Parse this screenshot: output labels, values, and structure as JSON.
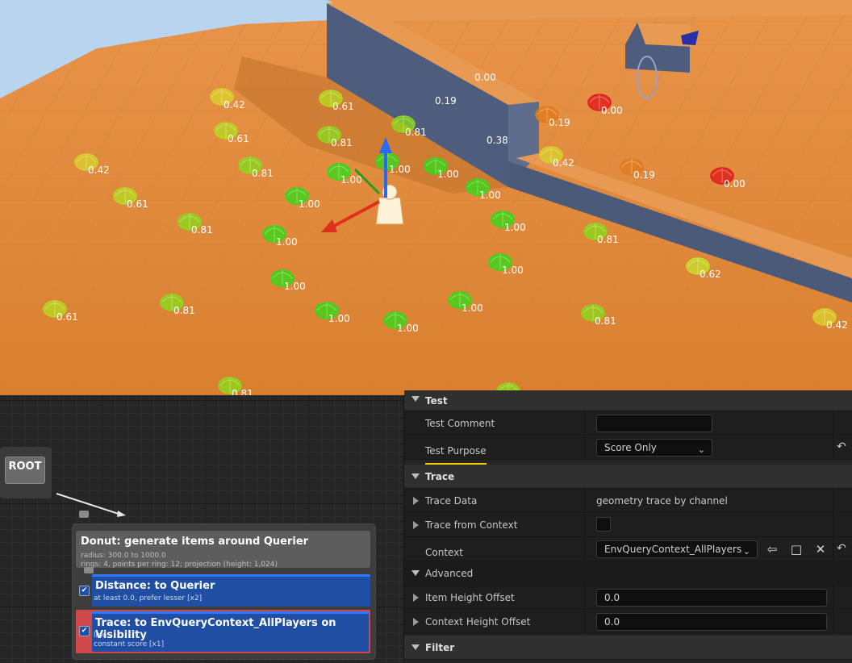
{
  "viewport": {
    "points": [
      {
        "label": "0.42",
        "color": "#d9cf2a"
      },
      {
        "label": "0.61",
        "color": "#b7d81f"
      },
      {
        "label": "0.61",
        "color": "#b7d81f"
      },
      {
        "label": "0.81",
        "color": "#8bd81a"
      },
      {
        "label": "0.42",
        "color": "#d9cf2a"
      },
      {
        "label": "0.81",
        "color": "#8bd81a"
      },
      {
        "label": "0.81",
        "color": "#8bd81a"
      },
      {
        "label": "0.61",
        "color": "#b7d81f"
      },
      {
        "label": "1.00",
        "color": "#36d818"
      },
      {
        "label": "1.00",
        "color": "#36d818"
      },
      {
        "label": "1.00",
        "color": "#36d818"
      },
      {
        "label": "1.00",
        "color": "#36d818"
      },
      {
        "label": "1.00",
        "color": "#36d818"
      },
      {
        "label": "0.81",
        "color": "#8bd81a"
      },
      {
        "label": "1.00",
        "color": "#36d818"
      },
      {
        "label": "1.00",
        "color": "#36d818"
      },
      {
        "label": "1.00",
        "color": "#36d818"
      },
      {
        "label": "0.61",
        "color": "#b7d81f"
      },
      {
        "label": "0.81",
        "color": "#8bd81a"
      },
      {
        "label": "1.00",
        "color": "#36d818"
      },
      {
        "label": "1.00",
        "color": "#36d818"
      },
      {
        "label": "1.00",
        "color": "#36d818"
      },
      {
        "label": "1.00",
        "color": "#36d818"
      },
      {
        "label": "0.81",
        "color": "#8bd81a"
      },
      {
        "label": "0.42",
        "color": "#d9cf2a"
      },
      {
        "label": "0.19",
        "color": "#e07b1a"
      },
      {
        "label": "0.00",
        "color": "#e01a1a"
      },
      {
        "label": "0.81",
        "color": "#8bd81a"
      },
      {
        "label": "0.62",
        "color": "#c9dd2a"
      },
      {
        "label": "0.42",
        "color": "#d9cf2a"
      },
      {
        "label": "0.19",
        "color": "#e07b1a"
      },
      {
        "label": "0.00",
        "color": "#e01a1a"
      },
      {
        "label": "0.81",
        "color": "#8bd81a"
      },
      {
        "label": "0.81",
        "color": "#8bd81a"
      }
    ],
    "floating_labels": [
      "0.00",
      "0.19",
      "0.38"
    ],
    "colors": {
      "floor": "#e08a3a",
      "floor_light": "#f0a050",
      "wall_side": "#4a5a78",
      "wall_top": "#e89a52",
      "sky": "#b8d4ef"
    }
  },
  "graph": {
    "root_label": "ROOT",
    "generator": {
      "title": "Donut: generate items around Querier",
      "line1": "radius: 300.0 to 1000.0",
      "line2": "rings: 4, points per ring: 12; projection (height: 1,024)"
    },
    "tests": [
      {
        "title": "Distance: to Querier",
        "line1": "at least 0.0, prefer lesser [x2]",
        "line2": "",
        "checked": "✔"
      },
      {
        "title": "Trace: to EnvQueryContext_AllPlayers on Visibility",
        "line1": "line",
        "line2": "constant score [x1]",
        "checked": "✔"
      }
    ]
  },
  "details": {
    "categories": {
      "test": "Test",
      "trace": "Trace",
      "advanced": "Advanced",
      "filter": "Filter"
    },
    "test_comment": {
      "label": "Test Comment",
      "value": ""
    },
    "test_purpose": {
      "label": "Test Purpose",
      "value": "Score Only"
    },
    "trace_data": {
      "label": "Trace Data",
      "value": "geometry trace by channel"
    },
    "trace_from_context": {
      "label": "Trace from Context"
    },
    "context": {
      "label": "Context",
      "value": "EnvQueryContext_AllPlayers"
    },
    "item_height_offset": {
      "label": "Item Height Offset",
      "value": "0.0"
    },
    "context_height_offset": {
      "label": "Context Height Offset",
      "value": "0.0"
    },
    "icons": {
      "reset": "reset-arrow-icon",
      "browse": "browse-icon",
      "find": "find-in-browser-icon",
      "clear": "clear-icon"
    }
  }
}
